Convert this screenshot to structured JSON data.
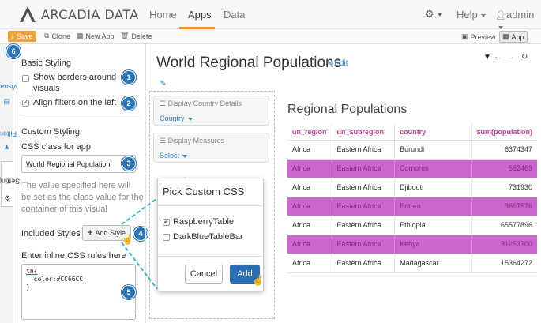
{
  "brand": {
    "name": "ARCADIA DATA"
  },
  "nav": {
    "links": [
      "Home",
      "Apps",
      "Data"
    ],
    "gear_icon": "gear-icon",
    "help_label": "Help",
    "user_label": "admin"
  },
  "toolbar": {
    "save": "Save",
    "clone": "Clone",
    "new_app": "New App",
    "delete": "Delete",
    "preview": "Preview",
    "app": "App"
  },
  "side_tabs": [
    "Visuals",
    "Filters",
    "Settings"
  ],
  "settings": {
    "basic_heading": "Basic Styling",
    "show_borders_line1": "Show borders around",
    "show_borders_line2": "visuals",
    "align_filters": "Align filters on the left",
    "custom_heading": "Custom Styling",
    "css_class_label": "CSS class for app",
    "css_class_value": "World Regional Population",
    "help_line1": "The value specified here will",
    "help_line2": "be set as the class value for the",
    "help_line3": "container of this visual",
    "included_styles_label": "Included Styles",
    "add_style_button": "Add Style",
    "inline_css_label": "Enter inline CSS rules here",
    "css_code": [
      "th{",
      "  color:#CC66CC;",
      "}"
    ]
  },
  "badges": [
    "6",
    "1",
    "2",
    "3",
    "4",
    "5"
  ],
  "app": {
    "title": "World Regional Populations",
    "edit": "Edit"
  },
  "filters": [
    {
      "title": "Display Country Details",
      "select": "Country"
    },
    {
      "title": "Display Measures",
      "select": "Select"
    }
  ],
  "modal": {
    "title": "Pick Custom CSS",
    "options": [
      {
        "label": "RaspberryTable",
        "checked": true
      },
      {
        "label": "DarkBlueTableBar",
        "checked": false
      }
    ],
    "cancel": "Cancel",
    "add": "Add"
  },
  "visual": {
    "title": "Regional Populations",
    "columns": [
      "un_region",
      "un_subregion",
      "country",
      "sum(population)"
    ],
    "rows": [
      [
        "Africa",
        "Eastern Africa",
        "Burundi",
        "6374347"
      ],
      [
        "Africa",
        "Eastern Africa",
        "Comoros",
        "562469"
      ],
      [
        "Africa",
        "Eastern Africa",
        "Djibouti",
        "731930"
      ],
      [
        "Africa",
        "Eastern Africa",
        "Eritrea",
        "3667576"
      ],
      [
        "Africa",
        "Eastern Africa",
        "Ethiopia",
        "65577896"
      ],
      [
        "Africa",
        "Eastern Africa",
        "Kenya",
        "31253700"
      ],
      [
        "Africa",
        "Eastern Africa",
        "Madagascar",
        "15364272"
      ]
    ],
    "highlight_rows": [
      1,
      3,
      5
    ],
    "highlight_color": "#CC66CC"
  },
  "colors": {
    "accent_orange": "#e29230",
    "link_blue": "#2b7cc3",
    "badge_blue": "#2a75b8",
    "header_magenta": "#c0409f"
  }
}
